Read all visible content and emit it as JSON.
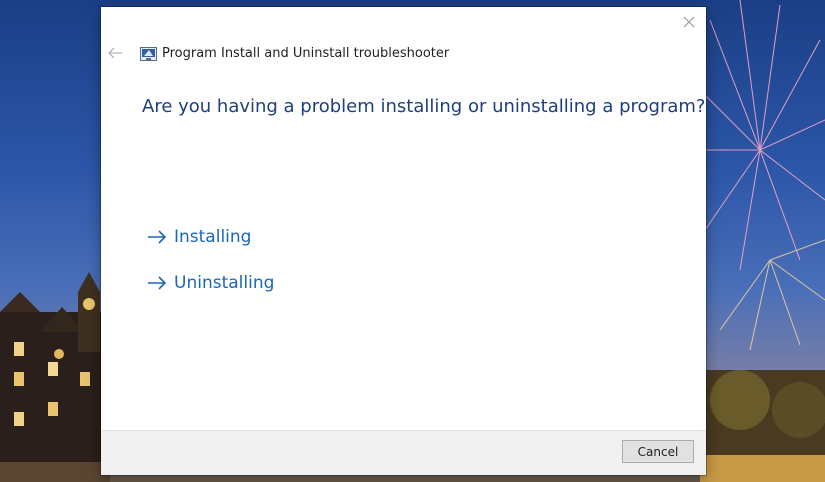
{
  "window": {
    "title": "Program Install and Uninstall troubleshooter",
    "close_icon": "close-icon",
    "back_icon": "back-arrow-icon",
    "app_icon": "troubleshooter-app-icon"
  },
  "main": {
    "question": "Are you having a problem installing or uninstalling a program?",
    "options": [
      {
        "label": "Installing",
        "icon": "arrow-right-icon"
      },
      {
        "label": "Uninstalling",
        "icon": "arrow-right-icon"
      }
    ]
  },
  "footer": {
    "cancel_label": "Cancel"
  },
  "colors": {
    "question_text": "#1e3f7a",
    "link": "#1a67b8",
    "footer_bg": "#f0f0f0"
  }
}
